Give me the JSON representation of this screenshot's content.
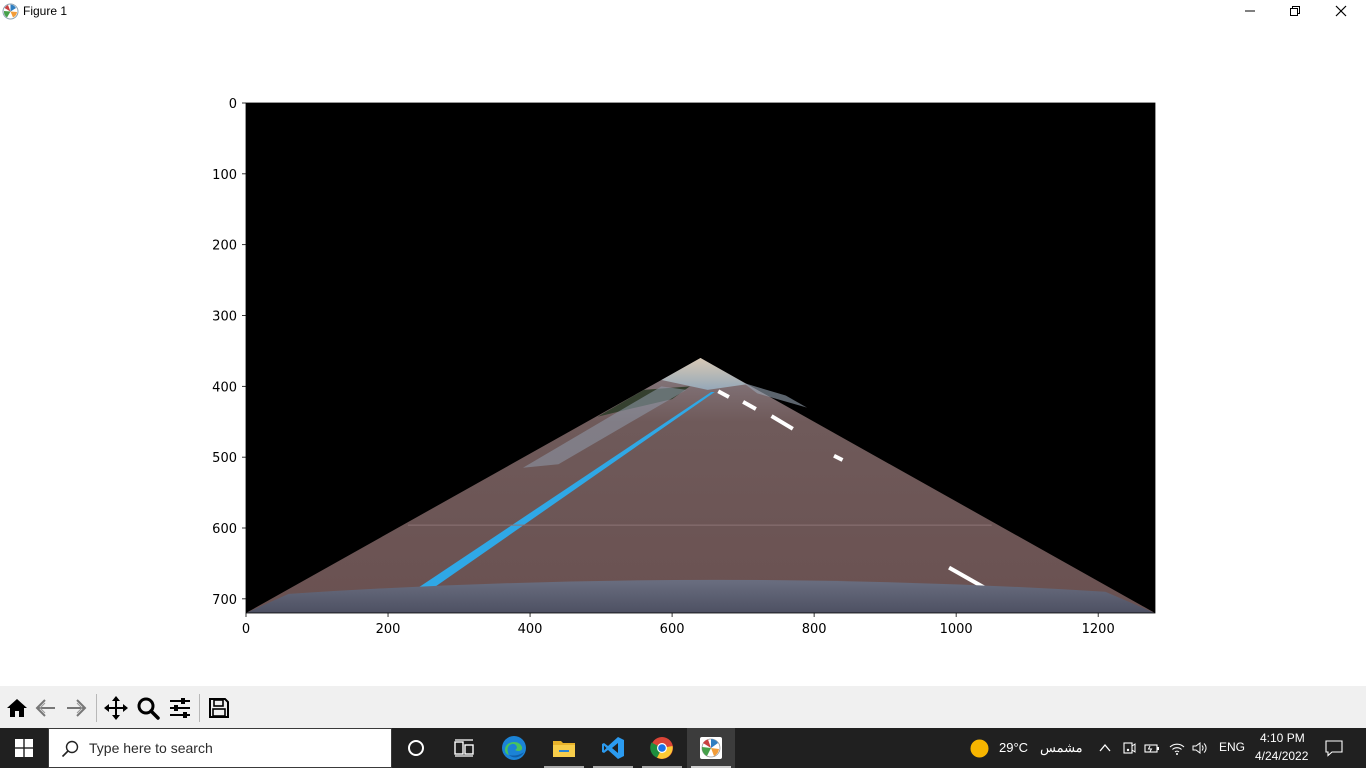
{
  "window": {
    "title": "Figure 1",
    "controls": {
      "minimize": "minimize",
      "restore": "restore",
      "close": "close"
    }
  },
  "chart_data": {
    "type": "image",
    "title": "",
    "xlabel": "",
    "ylabel": "",
    "xlim": [
      0,
      1280
    ],
    "ylim": [
      720,
      0
    ],
    "xticks": [
      0,
      200,
      400,
      600,
      800,
      1000,
      1200
    ],
    "yticks": [
      0,
      100,
      200,
      300,
      400,
      500,
      600,
      700
    ],
    "xtick_labels": [
      "0",
      "200",
      "400",
      "600",
      "800",
      "1000",
      "1200"
    ],
    "ytick_labels": [
      "0",
      "100",
      "200",
      "300",
      "400",
      "500",
      "600",
      "700"
    ],
    "grid": false,
    "mask_region_vertices": [
      [
        0,
        720
      ],
      [
        640,
        360
      ],
      [
        1280,
        720
      ]
    ],
    "colors": {
      "background": "#000000",
      "road": "#6e5554",
      "sky": "#a9b7c0",
      "left_lane_line": "#2fa8e6",
      "right_lane_line": "#ffffff",
      "hood": "#5a5d6e"
    }
  },
  "toolbar": {
    "buttons": [
      {
        "icon": "home-icon"
      },
      {
        "icon": "back-icon"
      },
      {
        "icon": "forward-icon"
      },
      {
        "icon": "pan-icon"
      },
      {
        "icon": "zoom-icon"
      },
      {
        "icon": "configure-subplots-icon"
      },
      {
        "icon": "save-icon"
      }
    ]
  },
  "taskbar": {
    "search_placeholder": "Type here to search",
    "apps": [
      {
        "icon": "cortana-icon"
      },
      {
        "icon": "task-view-icon"
      },
      {
        "icon": "edge-icon"
      },
      {
        "icon": "file-explorer-icon"
      },
      {
        "icon": "vscode-icon"
      },
      {
        "icon": "chrome-icon"
      },
      {
        "icon": "matplotlib-icon"
      }
    ],
    "weather": {
      "temp": "29°C",
      "condition": "مشمس"
    },
    "language": "ENG",
    "time": "4:10 PM",
    "date": "4/24/2022"
  }
}
